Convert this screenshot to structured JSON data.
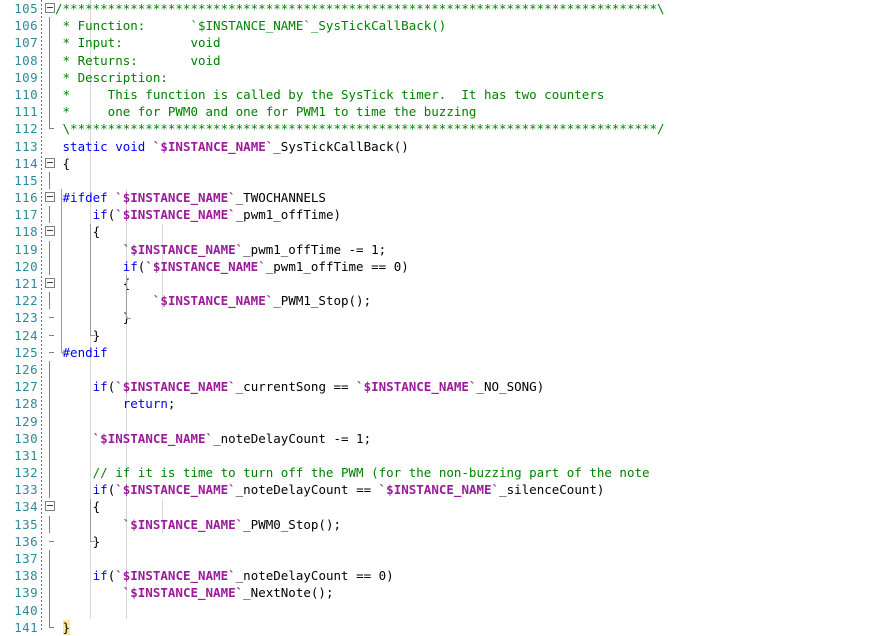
{
  "editor": {
    "type": "code-editor",
    "language": "C",
    "first_visible_line": 105,
    "last_visible_line": 141,
    "background": "#ffffff",
    "line_number_color": "#2f8a99",
    "colors": {
      "comment": "#008000",
      "keyword": "#0000ff",
      "preprocessor": "#0000ff",
      "instance_macro": "#9b1b9b",
      "plain": "#000000",
      "fold_marker": "#808080",
      "indent_guide": "#d8d8d8"
    }
  },
  "lines": [
    {
      "n": "105",
      "fold": "box",
      "text": "/*******************************************************************************\\"
    },
    {
      "n": "106",
      "fold": "line",
      "text": " * Function:      `$INSTANCE_NAME`_SysTickCallBack()"
    },
    {
      "n": "107",
      "fold": "line",
      "text": " * Input:         void"
    },
    {
      "n": "108",
      "fold": "line",
      "text": " * Returns:       void"
    },
    {
      "n": "109",
      "fold": "line",
      "text": " * Description:"
    },
    {
      "n": "110",
      "fold": "line",
      "text": " *     This function is called by the SysTick timer.  It has two counters"
    },
    {
      "n": "111",
      "fold": "line",
      "text": " *     one for PWM0 and one for PWM1 to time the buzzing"
    },
    {
      "n": "112",
      "fold": "end",
      "text": " \\******************************************************************************/"
    },
    {
      "n": "113",
      "fold": "none",
      "text": " static void `$INSTANCE_NAME`_SysTickCallBack()"
    },
    {
      "n": "114",
      "fold": "box",
      "text": " {"
    },
    {
      "n": "115",
      "fold": "line",
      "text": ""
    },
    {
      "n": "116",
      "fold": "box",
      "text": " #ifdef `$INSTANCE_NAME`_TWOCHANNELS"
    },
    {
      "n": "117",
      "fold": "line",
      "text": "     if(`$INSTANCE_NAME`_pwm1_offTime)"
    },
    {
      "n": "118",
      "fold": "box",
      "text": "     {"
    },
    {
      "n": "119",
      "fold": "line",
      "text": "         `$INSTANCE_NAME`_pwm1_offTime -= 1;"
    },
    {
      "n": "120",
      "fold": "line",
      "text": "         if(`$INSTANCE_NAME`_pwm1_offTime == 0)"
    },
    {
      "n": "121",
      "fold": "box",
      "text": "         {"
    },
    {
      "n": "122",
      "fold": "line",
      "text": "             `$INSTANCE_NAME`_PWM1_Stop();"
    },
    {
      "n": "123",
      "fold": "tick",
      "text": "         }"
    },
    {
      "n": "124",
      "fold": "tick",
      "text": "     }"
    },
    {
      "n": "125",
      "fold": "tick",
      "text": " #endif"
    },
    {
      "n": "126",
      "fold": "line",
      "text": ""
    },
    {
      "n": "127",
      "fold": "line",
      "text": "     if(`$INSTANCE_NAME`_currentSong == `$INSTANCE_NAME`_NO_SONG)"
    },
    {
      "n": "128",
      "fold": "line",
      "text": "         return;"
    },
    {
      "n": "129",
      "fold": "line",
      "text": ""
    },
    {
      "n": "130",
      "fold": "line",
      "text": "     `$INSTANCE_NAME`_noteDelayCount -= 1;"
    },
    {
      "n": "131",
      "fold": "line",
      "text": ""
    },
    {
      "n": "132",
      "fold": "line",
      "text": "     // if it is time to turn off the PWM (for the non-buzzing part of the note"
    },
    {
      "n": "133",
      "fold": "line",
      "text": "     if(`$INSTANCE_NAME`_noteDelayCount == `$INSTANCE_NAME`_silenceCount)"
    },
    {
      "n": "134",
      "fold": "box",
      "text": "     {"
    },
    {
      "n": "135",
      "fold": "line",
      "text": "         `$INSTANCE_NAME`_PWM0_Stop();"
    },
    {
      "n": "136",
      "fold": "tick",
      "text": "     }"
    },
    {
      "n": "137",
      "fold": "line",
      "text": ""
    },
    {
      "n": "138",
      "fold": "line",
      "text": "     if(`$INSTANCE_NAME`_noteDelayCount == 0)"
    },
    {
      "n": "139",
      "fold": "line",
      "text": "         `$INSTANCE_NAME`_NextNote();"
    },
    {
      "n": "140",
      "fold": "line",
      "text": ""
    },
    {
      "n": "141",
      "fold": "end",
      "text": " }"
    }
  ],
  "indent_guides_x": [
    90,
    126,
    162,
    199
  ],
  "highlighted_brace_line": "141"
}
